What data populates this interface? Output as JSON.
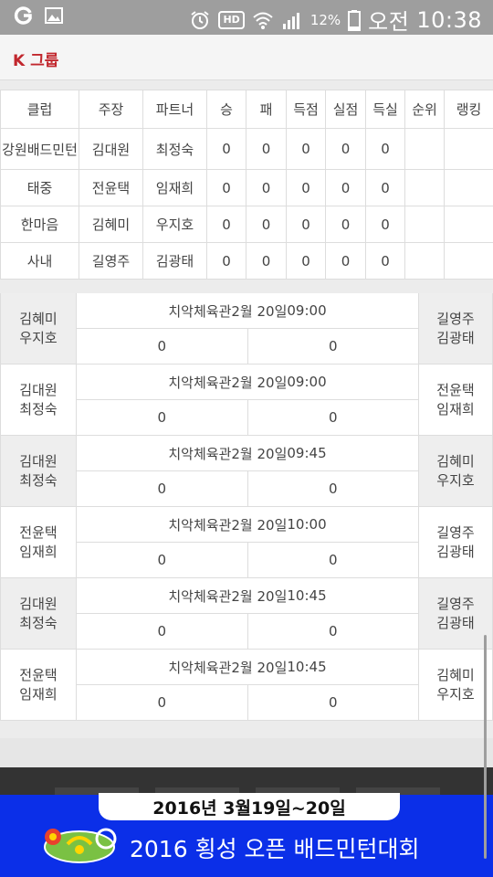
{
  "status_bar": {
    "battery": "12%",
    "ampm": "오전",
    "time": "10:38",
    "hd_label": "HD"
  },
  "header": {
    "title": "K 그룹"
  },
  "standings": {
    "columns": [
      "클럽",
      "주장",
      "파트너",
      "승",
      "패",
      "득점",
      "실점",
      "득실",
      "순위",
      "랭킹"
    ],
    "rows": [
      {
        "club": "강원배드민턴",
        "captain": "김대원",
        "partner": "최정숙",
        "win": "0",
        "loss": "0",
        "for": "0",
        "against": "0",
        "diff": "0",
        "rank": "",
        "ranking": ""
      },
      {
        "club": "태중",
        "captain": "전윤택",
        "partner": "임재희",
        "win": "0",
        "loss": "0",
        "for": "0",
        "against": "0",
        "diff": "0",
        "rank": "",
        "ranking": ""
      },
      {
        "club": "한마음",
        "captain": "김혜미",
        "partner": "우지호",
        "win": "0",
        "loss": "0",
        "for": "0",
        "against": "0",
        "diff": "0",
        "rank": "",
        "ranking": ""
      },
      {
        "club": "사내",
        "captain": "길영주",
        "partner": "김광태",
        "win": "0",
        "loss": "0",
        "for": "0",
        "against": "0",
        "diff": "0",
        "rank": "",
        "ranking": ""
      }
    ]
  },
  "matches": [
    {
      "left1": "김혜미",
      "left2": "우지호",
      "venue": "치악체육관",
      "date": "2월 20일",
      "time": "09:00",
      "score_left": "0",
      "score_right": "0",
      "right1": "길영주",
      "right2": "김광태"
    },
    {
      "left1": "김대원",
      "left2": "최정숙",
      "venue": "치악체육관",
      "date": "2월 20일",
      "time": "09:00",
      "score_left": "0",
      "score_right": "0",
      "right1": "전윤택",
      "right2": "임재희"
    },
    {
      "left1": "김대원",
      "left2": "최정숙",
      "venue": "치악체육관",
      "date": "2월 20일",
      "time": "09:45",
      "score_left": "0",
      "score_right": "0",
      "right1": "김혜미",
      "right2": "우지호"
    },
    {
      "left1": "전윤택",
      "left2": "임재희",
      "venue": "치악체육관",
      "date": "2월 20일",
      "time": "10:00",
      "score_left": "0",
      "score_right": "0",
      "right1": "길영주",
      "right2": "김광태"
    },
    {
      "left1": "김대원",
      "left2": "최정숙",
      "venue": "치악체육관",
      "date": "2월 20일",
      "time": "10:45",
      "score_left": "0",
      "score_right": "0",
      "right1": "길영주",
      "right2": "김광태"
    },
    {
      "left1": "전윤택",
      "left2": "임재희",
      "venue": "치악체육관",
      "date": "2월 20일",
      "time": "10:45",
      "score_left": "0",
      "score_right": "0",
      "right1": "김혜미",
      "right2": "우지호"
    }
  ],
  "banner": {
    "date": "2016년 3월19일~20일",
    "title": "2016 횡성 오픈 배드민턴대회"
  },
  "colors": {
    "accent_red": "#c1272d",
    "banner_blue": "#0b2fe8",
    "status_gray": "#9e9e9e"
  }
}
